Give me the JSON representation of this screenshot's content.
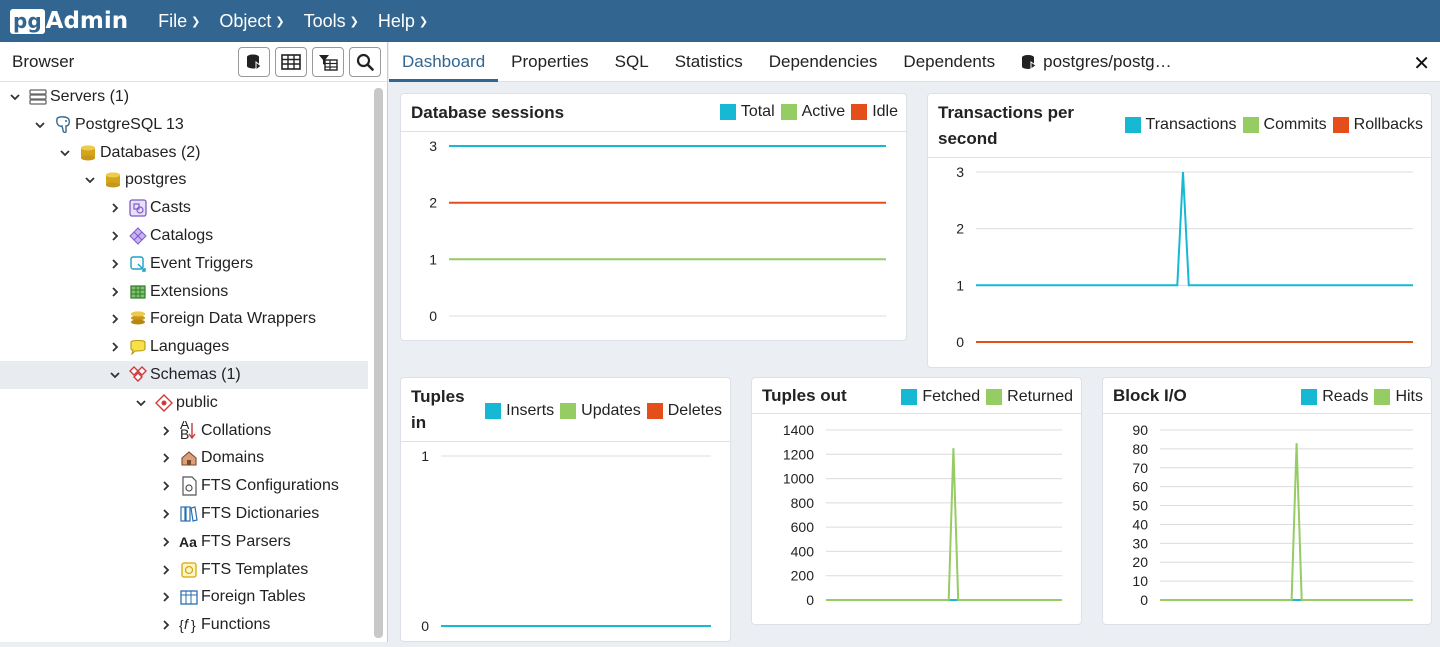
{
  "app": {
    "logo_prefix": "pg",
    "logo_suffix": "Admin"
  },
  "menu": [
    {
      "label": "File"
    },
    {
      "label": "Object"
    },
    {
      "label": "Tools"
    },
    {
      "label": "Help"
    }
  ],
  "browser": {
    "title": "Browser",
    "tree": [
      {
        "label": "Servers (1)",
        "level": 0,
        "expanded": true,
        "icon": "servers-icon"
      },
      {
        "label": "PostgreSQL 13",
        "level": 1,
        "expanded": true,
        "icon": "postgres-server-icon"
      },
      {
        "label": "Databases (2)",
        "level": 2,
        "expanded": true,
        "icon": "databases-icon"
      },
      {
        "label": "postgres",
        "level": 3,
        "expanded": true,
        "icon": "database-icon"
      },
      {
        "label": "Casts",
        "level": 4,
        "expanded": false,
        "icon": "casts-icon"
      },
      {
        "label": "Catalogs",
        "level": 4,
        "expanded": false,
        "icon": "catalogs-icon"
      },
      {
        "label": "Event Triggers",
        "level": 4,
        "expanded": false,
        "icon": "event-triggers-icon"
      },
      {
        "label": "Extensions",
        "level": 4,
        "expanded": false,
        "icon": "extensions-icon"
      },
      {
        "label": "Foreign Data Wrappers",
        "level": 4,
        "expanded": false,
        "icon": "fdw-icon"
      },
      {
        "label": "Languages",
        "level": 4,
        "expanded": false,
        "icon": "languages-icon"
      },
      {
        "label": "Schemas (1)",
        "level": 4,
        "expanded": true,
        "icon": "schemas-icon",
        "selected": true
      },
      {
        "label": "public",
        "level": 5,
        "expanded": true,
        "icon": "schema-icon"
      },
      {
        "label": "Collations",
        "level": 6,
        "expanded": false,
        "icon": "collations-icon"
      },
      {
        "label": "Domains",
        "level": 6,
        "expanded": false,
        "icon": "domains-icon"
      },
      {
        "label": "FTS Configurations",
        "level": 6,
        "expanded": false,
        "icon": "fts-configurations-icon"
      },
      {
        "label": "FTS Dictionaries",
        "level": 6,
        "expanded": false,
        "icon": "fts-dictionaries-icon"
      },
      {
        "label": "FTS Parsers",
        "level": 6,
        "expanded": false,
        "icon": "fts-parsers-icon"
      },
      {
        "label": "FTS Templates",
        "level": 6,
        "expanded": false,
        "icon": "fts-templates-icon"
      },
      {
        "label": "Foreign Tables",
        "level": 6,
        "expanded": false,
        "icon": "foreign-tables-icon"
      },
      {
        "label": "Functions",
        "level": 6,
        "expanded": false,
        "icon": "functions-icon"
      }
    ]
  },
  "tabs": [
    {
      "label": "Dashboard",
      "active": true
    },
    {
      "label": "Properties"
    },
    {
      "label": "SQL"
    },
    {
      "label": "Statistics"
    },
    {
      "label": "Dependencies"
    },
    {
      "label": "Dependents"
    },
    {
      "label": "postgres/postg…",
      "icon": "database-icon"
    }
  ],
  "colors": {
    "cyan": "#17b8d4",
    "green": "#95cc63",
    "orange": "#e54e1b",
    "brand": "#326690"
  },
  "chart_data": [
    {
      "id": "sessions",
      "type": "line",
      "title": "Database sessions",
      "series": [
        {
          "name": "Total",
          "color": "#17b8d4",
          "values": [
            3,
            3,
            3,
            3,
            3,
            3,
            3,
            3,
            3,
            3,
            3
          ]
        },
        {
          "name": "Active",
          "color": "#95cc63",
          "values": [
            1,
            1,
            1,
            1,
            1,
            1,
            1,
            1,
            1,
            1,
            1
          ]
        },
        {
          "name": "Idle",
          "color": "#e54e1b",
          "values": [
            2,
            2,
            2,
            2,
            2,
            2,
            2,
            2,
            2,
            2,
            2
          ]
        }
      ],
      "yticks": [
        0,
        1,
        2,
        3
      ],
      "ylim": [
        0,
        3
      ]
    },
    {
      "id": "transactions",
      "type": "line",
      "title": "Transactions per second",
      "series": [
        {
          "name": "Transactions",
          "color": "#17b8d4",
          "values": [
            1,
            1,
            1,
            1,
            1,
            1,
            1,
            1,
            1,
            1,
            1,
            1,
            1,
            1,
            1,
            1,
            1,
            1,
            1,
            1,
            1,
            1,
            1,
            1,
            1,
            1,
            1,
            1,
            1,
            1,
            1,
            1,
            1,
            1,
            1,
            1,
            3,
            1,
            1,
            1,
            1,
            1,
            1,
            1,
            1,
            1,
            1,
            1,
            1,
            1,
            1,
            1,
            1,
            1,
            1,
            1,
            1,
            1,
            1,
            1,
            1,
            1,
            1,
            1,
            1,
            1,
            1,
            1,
            1,
            1,
            1,
            1,
            1,
            1,
            1,
            1,
            1
          ]
        },
        {
          "name": "Commits",
          "color": "#95cc63",
          "values": []
        },
        {
          "name": "Rollbacks",
          "color": "#e54e1b",
          "values": [
            0,
            0,
            0,
            0,
            0,
            0,
            0,
            0,
            0,
            0,
            0
          ]
        }
      ],
      "yticks": [
        0,
        1,
        2,
        3
      ],
      "ylim": [
        0,
        3
      ]
    },
    {
      "id": "tuples_in",
      "type": "line",
      "title": "Tuples in",
      "series": [
        {
          "name": "Inserts",
          "color": "#17b8d4",
          "values": [
            0,
            0,
            0,
            0,
            0,
            0,
            0,
            0,
            0,
            0,
            0
          ]
        },
        {
          "name": "Updates",
          "color": "#95cc63",
          "values": []
        },
        {
          "name": "Deletes",
          "color": "#e54e1b",
          "values": []
        }
      ],
      "yticks": [
        0,
        1
      ],
      "ylim": [
        0,
        1
      ]
    },
    {
      "id": "tuples_out",
      "type": "line",
      "title": "Tuples out",
      "series": [
        {
          "name": "Fetched",
          "color": "#17b8d4",
          "values": [
            0,
            0,
            0,
            0,
            0,
            0,
            0,
            0,
            0,
            0,
            0,
            0,
            0,
            0,
            0,
            0,
            0,
            0,
            0,
            0,
            0,
            0,
            0,
            0,
            0,
            0,
            0,
            0,
            0,
            0,
            0,
            0,
            0,
            0,
            0,
            0,
            0,
            0,
            0,
            0,
            0,
            0,
            0,
            0,
            0,
            0,
            0,
            0,
            0,
            0,
            0
          ]
        },
        {
          "name": "Returned",
          "color": "#95cc63",
          "values": [
            0,
            0,
            0,
            0,
            0,
            0,
            0,
            0,
            0,
            0,
            0,
            0,
            0,
            0,
            0,
            0,
            0,
            0,
            0,
            0,
            0,
            0,
            0,
            0,
            0,
            0,
            0,
            1250,
            0,
            0,
            0,
            0,
            0,
            0,
            0,
            0,
            0,
            0,
            0,
            0,
            0,
            0,
            0,
            0,
            0,
            0,
            0,
            0,
            0,
            0,
            0
          ]
        }
      ],
      "yticks": [
        0,
        200,
        400,
        600,
        800,
        1000,
        1200,
        1400
      ],
      "ylim": [
        0,
        1400
      ]
    },
    {
      "id": "block_io",
      "type": "line",
      "title": "Block I/O",
      "series": [
        {
          "name": "Reads",
          "color": "#17b8d4",
          "values": [
            0,
            0,
            0,
            0,
            0,
            0,
            0,
            0,
            0,
            0,
            0,
            0,
            0,
            0,
            0,
            0,
            0,
            0,
            0,
            0,
            0,
            0,
            0,
            0,
            0,
            0,
            0,
            0,
            0,
            0,
            0,
            0,
            0,
            0,
            0,
            0,
            0,
            0,
            0,
            0,
            0,
            0,
            0,
            0,
            0,
            0,
            0,
            0,
            0,
            0,
            0
          ]
        },
        {
          "name": "Hits",
          "color": "#95cc63",
          "values": [
            0,
            0,
            0,
            0,
            0,
            0,
            0,
            0,
            0,
            0,
            0,
            0,
            0,
            0,
            0,
            0,
            0,
            0,
            0,
            0,
            0,
            0,
            0,
            0,
            0,
            0,
            0,
            83,
            0,
            0,
            0,
            0,
            0,
            0,
            0,
            0,
            0,
            0,
            0,
            0,
            0,
            0,
            0,
            0,
            0,
            0,
            0,
            0,
            0,
            0,
            0
          ]
        }
      ],
      "yticks": [
        0,
        10,
        20,
        30,
        40,
        50,
        60,
        70,
        80,
        90
      ],
      "ylim": [
        0,
        90
      ]
    }
  ]
}
